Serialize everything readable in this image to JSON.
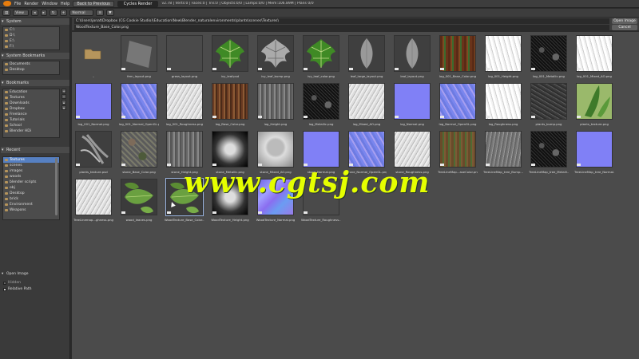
{
  "menu": {
    "file": "File",
    "render": "Render",
    "window": "Window",
    "help": "Help"
  },
  "top": {
    "back_label": "Back to Previous",
    "engine": "Cycles Render",
    "stats": "v2.78 | Verts:0 | Faces:0 | Tris:0 | Objects:0/0 | Lamps:0/0 | Mem:106.89M | Plans 0/0"
  },
  "hdr2": {
    "view": "View",
    "mode": "Normal"
  },
  "sidebar": {
    "system_title": "System",
    "system_items": [
      "C:\\",
      "D:\\",
      "E:\\",
      "F:\\"
    ],
    "sysbook_title": "System Bookmarks",
    "sysbook_items": [
      "Documents",
      "Desktop"
    ],
    "bookmarks_title": "Bookmarks",
    "bookmark_items": [
      "Education",
      "Textures",
      "Downloads",
      "Dropbox",
      "Freelance",
      "Tutorials",
      "School",
      "Blender HDi"
    ],
    "recent_title": "Recent",
    "recent_items": [
      "Textures",
      "scenes",
      "images",
      "woods",
      "blender scripts",
      "obj",
      "Desktop",
      "brick",
      "Environment",
      "Weapons"
    ],
    "open_image_title": "Open Image",
    "option_relative": "Relative Path",
    "option_hidden": "Hidden"
  },
  "path": {
    "directory": "C:\\Users\\jonat\\Dropbox (CG Cookie Studio)\\Education\\New\\Blender_naturalenvironments\\plants\\scenes\\Textures\\",
    "filename": "WoodTexture_Base_Color.png",
    "open_button": "Open Image",
    "cancel_button": "Cancel"
  },
  "files": [
    {
      "name": "..",
      "kind": "folder"
    },
    {
      "name": "fern_layout.png",
      "kind": "gray"
    },
    {
      "name": "grass_layout.png",
      "kind": "gray"
    },
    {
      "name": "ivy_leaf.psd",
      "kind": "leaf"
    },
    {
      "name": "ivy_leaf_bump.png",
      "kind": "leafgray"
    },
    {
      "name": "ivy_leaf_color.png",
      "kind": "leaf"
    },
    {
      "name": "leaf_large_layout.png",
      "kind": "leafshape"
    },
    {
      "name": "leaf_layout.png",
      "kind": "leafshape"
    },
    {
      "name": "log_001_Base_Color.png",
      "kind": "wood"
    },
    {
      "name": "log_001_Height.png",
      "kind": "white"
    },
    {
      "name": "log_001_Metallic.png",
      "kind": "dark"
    },
    {
      "name": "log_001_Mixed_AO.png",
      "kind": "white"
    },
    {
      "name": "log_001_Normal.png",
      "kind": "normal"
    },
    {
      "name": "log_001_Normal_OpenGL.png",
      "kind": "normal2"
    },
    {
      "name": "log_001_Roughness.png",
      "kind": "light"
    },
    {
      "name": "log_Base_Color.png",
      "kind": "bark"
    },
    {
      "name": "log_Height.png",
      "kind": "roughmid"
    },
    {
      "name": "log_Metallic.png",
      "kind": "dark"
    },
    {
      "name": "log_Mixed_AO.png",
      "kind": "light"
    },
    {
      "name": "log_Normal.png",
      "kind": "normal"
    },
    {
      "name": "log_Normal_OpenGL.png",
      "kind": "normal2"
    },
    {
      "name": "log_Roughness.png",
      "kind": "white"
    },
    {
      "name": "plants_bump.png",
      "kind": "dkgray"
    },
    {
      "name": "plants_texture.png",
      "kind": "plantsgreen"
    },
    {
      "name": "plants_texture.psd",
      "kind": "plantsgray"
    },
    {
      "name": "stone_Base_Color.png",
      "kind": "stone"
    },
    {
      "name": "stone_Height.png",
      "kind": "roughmid"
    },
    {
      "name": "stone_Metallic.png",
      "kind": "blackfade"
    },
    {
      "name": "stone_Mixed_AO.png",
      "kind": "face"
    },
    {
      "name": "stone_Normal.png",
      "kind": "normal"
    },
    {
      "name": "stone_Normal_OpenGL.png",
      "kind": "normal2"
    },
    {
      "name": "stone_Roughness.png",
      "kind": "light"
    },
    {
      "name": "TreeLineMap...aseColor.png",
      "kind": "woodgreen"
    },
    {
      "name": "TreeLineMap_tree_Bump...",
      "kind": "pine"
    },
    {
      "name": "TreeLineMap_tree_Metalli...",
      "kind": "dark"
    },
    {
      "name": "TreeLineMap_tree_Normal.png",
      "kind": "normal"
    },
    {
      "name": "TreeLinemap...ghness.png",
      "kind": "light"
    },
    {
      "name": "wood_leaves.png",
      "kind": "leafgreen"
    },
    {
      "name": "WoodTexture_Base_Color...",
      "kind": "leafgreen",
      "selected": true
    },
    {
      "name": "WoodTexture_Height.png",
      "kind": "blackfade"
    },
    {
      "name": "WoodTexture_Normal.png",
      "kind": "rainbow"
    },
    {
      "name": "WoodTexture_Roughness...",
      "kind": "gray"
    }
  ],
  "watermark": "www.cgtsj.com",
  "colors": {
    "accent": "#5680c2",
    "bg": "#4b4b4b",
    "panel": "#3a3a3a"
  }
}
